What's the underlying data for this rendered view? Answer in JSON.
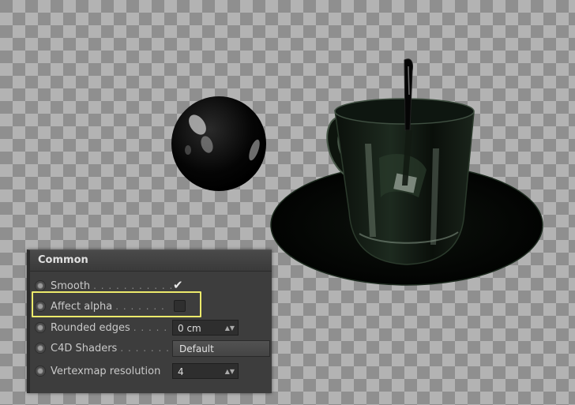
{
  "panel": {
    "title": "Common",
    "rows": [
      {
        "label": "Smooth",
        "dots": ". . . . . . . . . . .",
        "control": "checkbox",
        "checked": true,
        "checkmark": "✔"
      },
      {
        "label": "Affect alpha",
        "dots": ". . . . . . .",
        "control": "checkbox",
        "checked": false
      },
      {
        "label": "Rounded edges",
        "dots": ". . . . .",
        "control": "number",
        "value": "0 cm"
      },
      {
        "label": "C4D Shaders",
        "dots": ". . . . . . .",
        "control": "dropdown",
        "value": "Default"
      },
      {
        "label": "Vertexmap resolution",
        "dots": "",
        "control": "number",
        "value": "4"
      }
    ]
  },
  "spinner_glyph": "▲▼",
  "colors": {
    "highlight": "#ecea6b",
    "panel_bg": "#3d3d3d",
    "checker_dark": "#8f8f8f",
    "checker_light": "#b3b3b3"
  }
}
